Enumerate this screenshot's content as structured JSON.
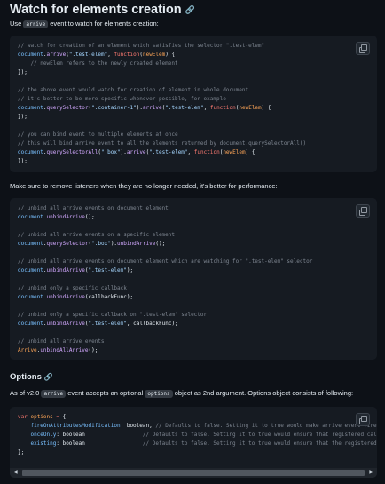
{
  "heading": {
    "title": "Watch for elements creation",
    "link_icon": "🔗"
  },
  "intro": {
    "before": "Use ",
    "code": "arrive",
    "after": " event to watch for elements creation:"
  },
  "block1": [
    [
      [
        "c",
        "// watch for creation of an element which satisfies the selector \".test-elem\""
      ]
    ],
    [
      [
        "n",
        "document"
      ],
      [
        "t",
        "."
      ],
      [
        "f",
        "arrive"
      ],
      [
        "t",
        "("
      ],
      [
        "s",
        "\".test-elem\""
      ],
      [
        "t",
        ", "
      ],
      [
        "k",
        "function"
      ],
      [
        "t",
        "("
      ],
      [
        "v",
        "newElem"
      ],
      [
        "t",
        ") {"
      ]
    ],
    [
      [
        "t",
        "    "
      ],
      [
        "c",
        "// newElem refers to the newly created element"
      ]
    ],
    [
      [
        "t",
        "});"
      ]
    ],
    [
      [
        "t",
        ""
      ]
    ],
    [
      [
        "c",
        "// the above event would watch for creation of element in whole document"
      ]
    ],
    [
      [
        "c",
        "// it's better to be more specific whenever possible, for example"
      ]
    ],
    [
      [
        "n",
        "document"
      ],
      [
        "t",
        "."
      ],
      [
        "f",
        "querySelector"
      ],
      [
        "t",
        "("
      ],
      [
        "s",
        "\".container-1\""
      ],
      [
        "t",
        ")."
      ],
      [
        "f",
        "arrive"
      ],
      [
        "t",
        "("
      ],
      [
        "s",
        "\".test-elem\""
      ],
      [
        "t",
        ", "
      ],
      [
        "k",
        "function"
      ],
      [
        "t",
        "("
      ],
      [
        "v",
        "newElem"
      ],
      [
        "t",
        ") {"
      ]
    ],
    [
      [
        "t",
        "});"
      ]
    ],
    [
      [
        "t",
        ""
      ]
    ],
    [
      [
        "c",
        "// you can bind event to multiple elements at once"
      ]
    ],
    [
      [
        "c",
        "// this will bind arrive event to all the elements returned by document.querySelectorAll()"
      ]
    ],
    [
      [
        "n",
        "document"
      ],
      [
        "t",
        "."
      ],
      [
        "f",
        "querySelectorAll"
      ],
      [
        "t",
        "("
      ],
      [
        "s",
        "\".box\""
      ],
      [
        "t",
        ")."
      ],
      [
        "f",
        "arrive"
      ],
      [
        "t",
        "("
      ],
      [
        "s",
        "\".test-elem\""
      ],
      [
        "t",
        ", "
      ],
      [
        "k",
        "function"
      ],
      [
        "t",
        "("
      ],
      [
        "v",
        "newElem"
      ],
      [
        "t",
        ") {"
      ]
    ],
    [
      [
        "t",
        "});"
      ]
    ]
  ],
  "note": "Make sure to remove listeners when they are no longer needed, it's better for performance:",
  "block2": [
    [
      [
        "c",
        "// unbind all arrive events on document element"
      ]
    ],
    [
      [
        "n",
        "document"
      ],
      [
        "t",
        "."
      ],
      [
        "f",
        "unbindArrive"
      ],
      [
        "t",
        "();"
      ]
    ],
    [
      [
        "t",
        ""
      ]
    ],
    [
      [
        "c",
        "// unbind all arrive events on a specific element"
      ]
    ],
    [
      [
        "n",
        "document"
      ],
      [
        "t",
        "."
      ],
      [
        "f",
        "querySelector"
      ],
      [
        "t",
        "("
      ],
      [
        "s",
        "\".box\""
      ],
      [
        "t",
        ")."
      ],
      [
        "f",
        "unbindArrive"
      ],
      [
        "t",
        "();"
      ]
    ],
    [
      [
        "t",
        ""
      ]
    ],
    [
      [
        "c",
        "// unbind all arrive events on document element which are watching for \".test-elem\" selector"
      ]
    ],
    [
      [
        "n",
        "document"
      ],
      [
        "t",
        "."
      ],
      [
        "f",
        "unbindArrive"
      ],
      [
        "t",
        "("
      ],
      [
        "s",
        "\".test-elem\""
      ],
      [
        "t",
        ");"
      ]
    ],
    [
      [
        "t",
        ""
      ]
    ],
    [
      [
        "c",
        "// unbind only a specific callback"
      ]
    ],
    [
      [
        "n",
        "document"
      ],
      [
        "t",
        "."
      ],
      [
        "f",
        "unbindArrive"
      ],
      [
        "t",
        "(callbackFunc);"
      ]
    ],
    [
      [
        "t",
        ""
      ]
    ],
    [
      [
        "c",
        "// unbind only a specific callback on \".test-elem\" selector"
      ]
    ],
    [
      [
        "n",
        "document"
      ],
      [
        "t",
        "."
      ],
      [
        "f",
        "unbindArrive"
      ],
      [
        "t",
        "("
      ],
      [
        "s",
        "\".test-elem\""
      ],
      [
        "t",
        ", callbackFunc);"
      ]
    ],
    [
      [
        "t",
        ""
      ]
    ],
    [
      [
        "c",
        "// unbind all arrive events"
      ]
    ],
    [
      [
        "p",
        "Arrive"
      ],
      [
        "t",
        "."
      ],
      [
        "f",
        "unbindAllArrive"
      ],
      [
        "t",
        "();"
      ]
    ]
  ],
  "options_heading": {
    "title": "Options",
    "link_icon": "🔗"
  },
  "options_intro": {
    "p1": "As of v2.0 ",
    "code1": "arrive",
    "p2": " event accepts an optional ",
    "code2": "options",
    "p3": " object as 2nd argument. Options object consists of following:"
  },
  "block3": [
    [
      [
        "k",
        "var"
      ],
      [
        "t",
        " "
      ],
      [
        "v",
        "options"
      ],
      [
        "t",
        " "
      ],
      [
        "k",
        "="
      ],
      [
        "t",
        " {"
      ]
    ],
    [
      [
        "t",
        "    "
      ],
      [
        "n",
        "fireOnAttributesModification"
      ],
      [
        "t",
        ": boolean, "
      ],
      [
        "c",
        "// Defaults to false. Setting it to true would make arrive event fire on existing elements"
      ]
    ],
    [
      [
        "t",
        "    "
      ],
      [
        "n",
        "onceOnly"
      ],
      [
        "t",
        ": boolean                  "
      ],
      [
        "c",
        "// Defaults to false. Setting it to true would ensure that registered callbacks"
      ]
    ],
    [
      [
        "t",
        "    "
      ],
      [
        "n",
        "existing"
      ],
      [
        "t",
        ": boolean                  "
      ],
      [
        "c",
        "// Defaults to false. Setting it to true would ensure that the registered callback"
      ]
    ],
    [
      [
        "t",
        "};"
      ]
    ]
  ],
  "scrollbar": {
    "left_arrow": "◀",
    "right_arrow": "▶"
  }
}
